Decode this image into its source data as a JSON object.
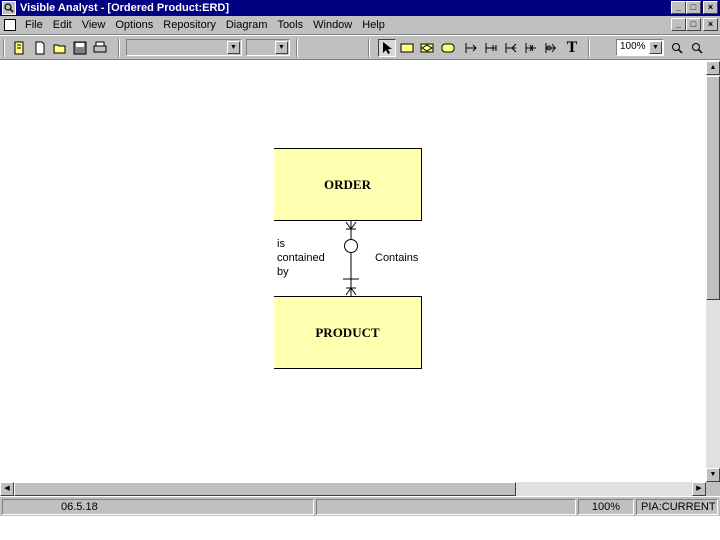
{
  "window": {
    "title": "Visible Analyst - [Ordered Product:ERD]",
    "caption_buttons": [
      "_",
      "□",
      "×"
    ]
  },
  "menu": {
    "items": [
      {
        "label": "File"
      },
      {
        "label": "Edit"
      },
      {
        "label": "View"
      },
      {
        "label": "Options"
      },
      {
        "label": "Repository"
      },
      {
        "label": "Diagram"
      },
      {
        "label": "Tools"
      },
      {
        "label": "Window"
      },
      {
        "label": "Help"
      }
    ],
    "mdi_buttons": [
      "_",
      "□",
      "×"
    ]
  },
  "toolbar": {
    "font_combo_value": "",
    "size_combo_value": "",
    "zoom_value": "100%",
    "icons": [
      "new-diagram-icon",
      "new-page-icon",
      "open-folder-icon",
      "save-icon",
      "print-icon",
      "select-pointer-icon",
      "entity-tool-icon",
      "associative-entity-tool-icon",
      "attributive-entity-tool-icon",
      "relationship-tool-1-icon",
      "relationship-tool-2-icon",
      "relationship-tool-3-icon",
      "relationship-tool-4-icon",
      "relationship-tool-5-icon",
      "text-tool-icon",
      "zoom-in-icon",
      "zoom-out-icon"
    ]
  },
  "diagram": {
    "entities": [
      {
        "name": "ORDER"
      },
      {
        "name": "PRODUCT"
      }
    ],
    "relationship": {
      "label_left": "is\ncontained\nby",
      "label_right": "Contains"
    }
  },
  "status": {
    "date": "06.5.18",
    "zoom": "100%",
    "project": "PIA:CURRENT"
  },
  "colors": {
    "titlebar": "#000080",
    "chrome": "#c0c0c0",
    "entity_fill": "#ffffb0"
  }
}
